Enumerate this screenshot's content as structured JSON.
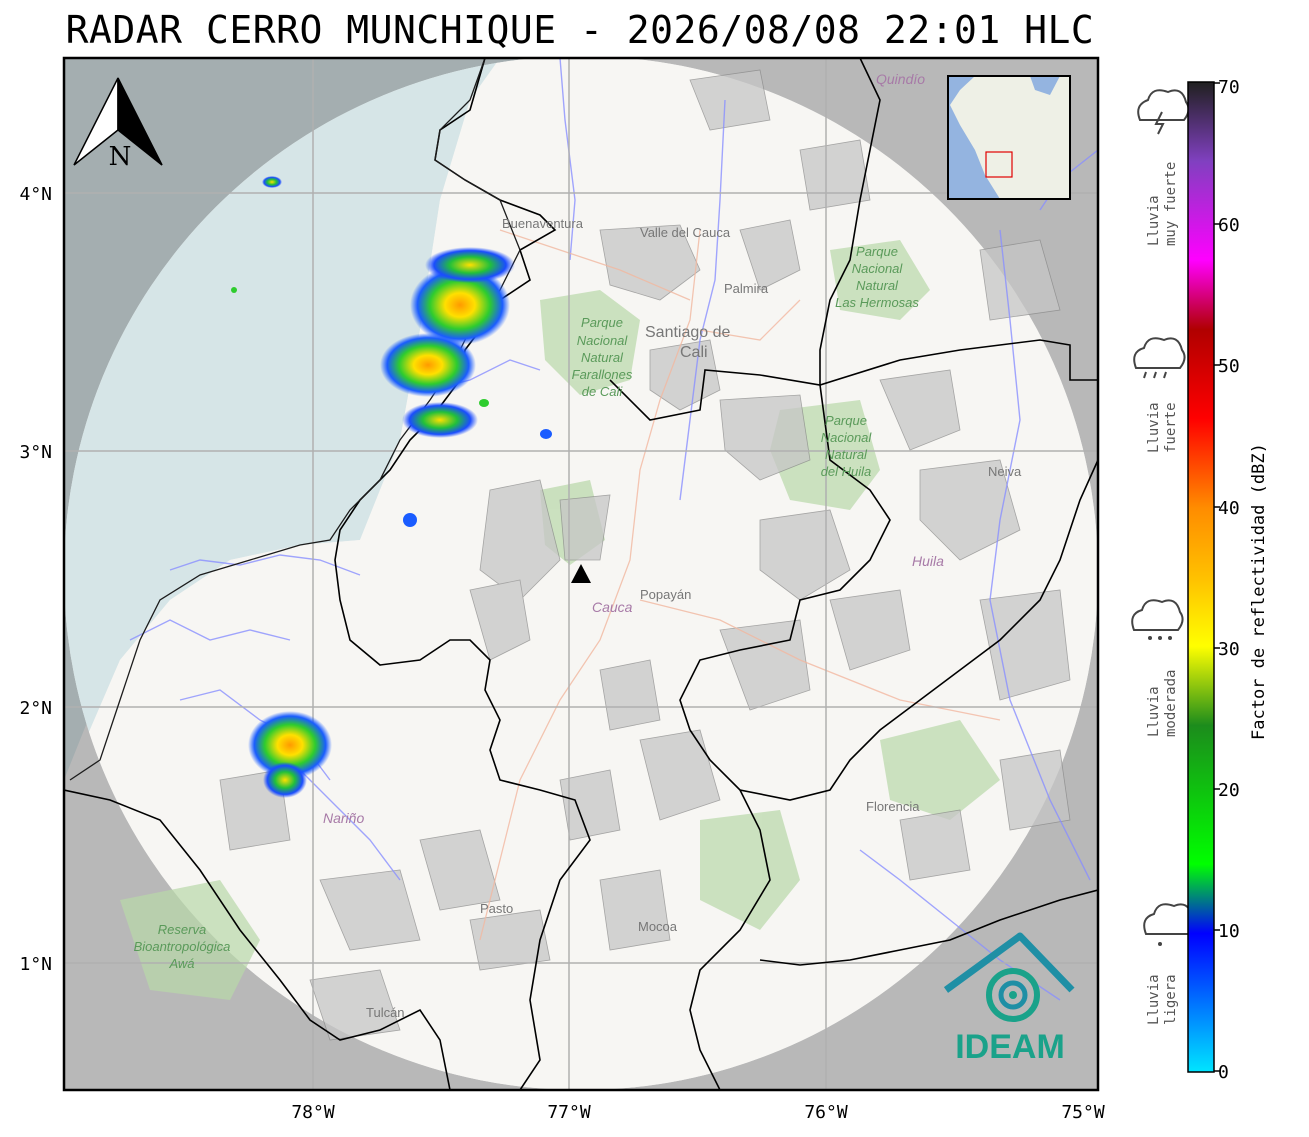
{
  "title": "RADAR CERRO MUNCHIQUE - 2026/08/08 22:01 HLC",
  "north_arrow_label": "N",
  "lat_ticks": [
    "4°N",
    "3°N",
    "2°N",
    "1°N"
  ],
  "lon_ticks": [
    "78°W",
    "77°W",
    "76°W",
    "75°W"
  ],
  "places": {
    "buenaventura": "Buenaventura",
    "valle": "Valle del Cauca",
    "palmira": "Palmira",
    "santiago1": "Santiago de",
    "santiago2": "Cali",
    "popayan": "Popayán",
    "cauca": "Cauca",
    "neiva": "Neiva",
    "huila": "Huila",
    "narino": "Nariño",
    "pasto": "Pasto",
    "mocoa": "Mocoa",
    "florencia": "Florencia",
    "tulcan": "Tulcán",
    "quindio": "Quindío"
  },
  "parks": {
    "farallones": [
      "Parque",
      "Nacional",
      "Natural",
      "Farallones",
      "de Cali"
    ],
    "hermosas": [
      "Parque",
      "Nacional",
      "Natural",
      "Las Hermosas"
    ],
    "huila_park": [
      "Parque",
      "Nacional",
      "Natural",
      "del Huila"
    ],
    "awa": [
      "Reserva",
      "Bioantropológica",
      "Awá"
    ]
  },
  "colorbar": {
    "label": "Factor de reflectividad (dBZ)",
    "ticks": [
      "70",
      "60",
      "50",
      "40",
      "30",
      "20",
      "10",
      "0"
    ]
  },
  "rain_legend": [
    {
      "line1": "Lluvia",
      "line2": "muy fuerte",
      "icon": "storm-cloud-icon"
    },
    {
      "line1": "Lluvia",
      "line2": "fuerte",
      "icon": "heavy-rain-cloud-icon"
    },
    {
      "line1": "Lluvia",
      "line2": "moderada",
      "icon": "moderate-rain-cloud-icon"
    },
    {
      "line1": "Lluvia",
      "line2": "ligera",
      "icon": "light-rain-cloud-icon"
    }
  ],
  "logo_text": "IDEAM",
  "colors": {
    "ocean": "#d4e4e6",
    "land": "#f7f6f3",
    "out_of_range": "#b4b4b4",
    "ideam": "#1aa28a"
  }
}
